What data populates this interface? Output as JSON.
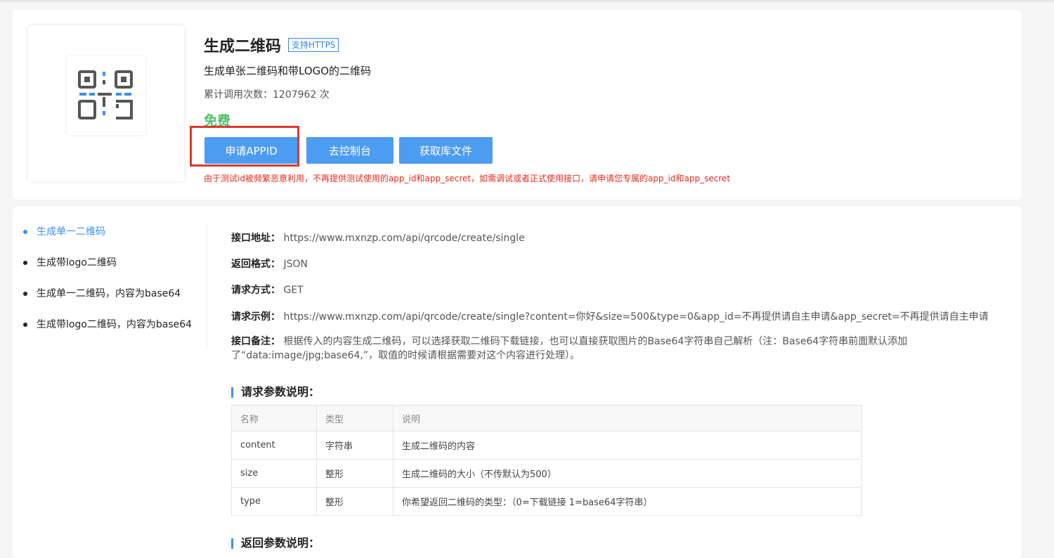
{
  "product": {
    "title": "生成二维码",
    "https_badge": "支持HTTPS",
    "subtitle": "生成单张二维码和带LOGO的二维码",
    "calls": "累计调用次数：1207962 次",
    "price": "免费",
    "buttons": {
      "apply": "申请APPID",
      "console": "去控制台",
      "library": "获取库文件"
    },
    "warning": "由于测试id被频繁恶意利用，不再提供测试使用的app_id和app_secret，如需调试或者正式使用接口，请申请您专属的app_id和app_secret",
    "logo_icon": "qr-code-icon"
  },
  "sidebar": {
    "items": [
      {
        "label": "生成单一二维码",
        "active": true
      },
      {
        "label": "生成带logo二维码",
        "active": false
      },
      {
        "label": "生成单一二维码，内容为base64",
        "active": false
      },
      {
        "label": "生成带logo二维码，内容为base64",
        "active": false
      }
    ]
  },
  "api": {
    "address_label": "接口地址：",
    "address": "https://www.mxnzp.com/api/qrcode/create/single",
    "format_label": "返回格式：",
    "format": "JSON",
    "method_label": "请求方式：",
    "method": "GET",
    "example_label": "请求示例：",
    "example": "https://www.mxnzp.com/api/qrcode/create/single?content=你好&size=500&type=0&app_id=不再提供请自主申请&app_secret=不再提供请自主申请",
    "note_label": "接口备注：",
    "note": "根据传入的内容生成二维码，可以选择获取二维码下载链接，也可以直接获取图片的Base64字符串自己解析（注：Base64字符串前面默认添加了“data:image/jpg;base64,”，取值的时候请根据需要对这个内容进行处理）。"
  },
  "request_params": {
    "title": "请求参数说明：",
    "headers": [
      "名称",
      "类型",
      "说明"
    ],
    "rows": [
      [
        "content",
        "字符串",
        "生成二维码的内容"
      ],
      [
        "size",
        "整形",
        "生成二维码的大小（不传默认为500）"
      ],
      [
        "type",
        "整形",
        "你希望返回二维码的类型：（0=下载链接 1=base64字符串）"
      ]
    ]
  },
  "response_params": {
    "title": "返回参数说明："
  },
  "colors": {
    "accent": "#3d8ef0",
    "button": "#4c9cf2",
    "free": "#4cc26b",
    "warning": "#e8281d",
    "highlight": "#d9392a"
  }
}
